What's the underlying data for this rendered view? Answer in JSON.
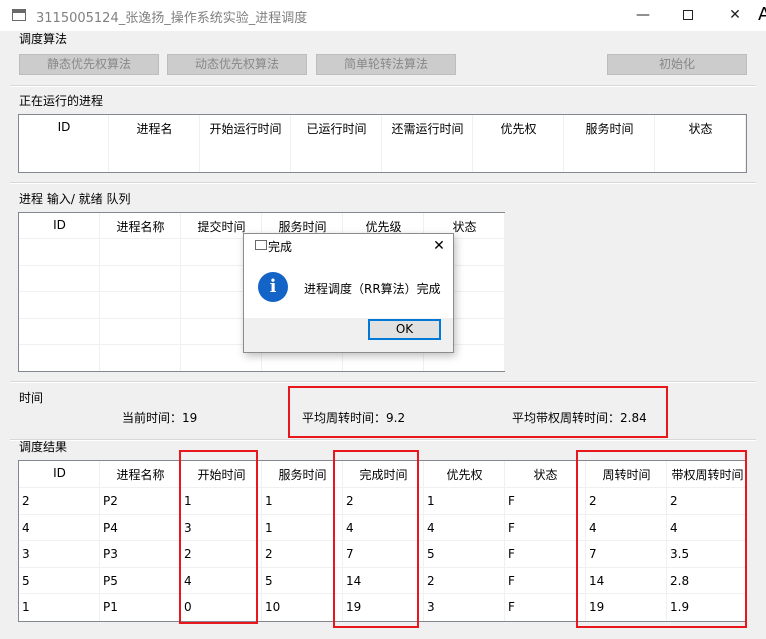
{
  "window": {
    "title": "3115005124_张逸扬_操作系统实验_进程调度",
    "min_glyph": "—",
    "close_glyph": "✕",
    "edge_char": "A"
  },
  "algo": {
    "label": "调度算法",
    "static_btn": "静态优先权算法",
    "dynamic_btn": "动态优先权算法",
    "rr_btn": "简单轮转法算法",
    "init_btn": "初始化"
  },
  "running": {
    "label": "正在运行的进程",
    "headers": [
      "ID",
      "进程名",
      "开始运行时间",
      "已运行时间",
      "还需运行时间",
      "优先权",
      "服务时间",
      "状态"
    ]
  },
  "queue": {
    "label": "进程 输入/ 就绪 队列",
    "headers": [
      "ID",
      "进程名称",
      "提交时间",
      "服务时间",
      "优先级",
      "状态"
    ]
  },
  "time": {
    "label": "时间",
    "current": "当前时间：19",
    "avg_turnaround": "平均周转时间：9.2",
    "avg_weighted": "平均带权周转时间：2.84"
  },
  "results": {
    "label": "调度结果",
    "headers": [
      "ID",
      "进程名称",
      "开始时间",
      "服务时间",
      "完成时间",
      "优先权",
      "状态",
      "周转时间",
      "带权周转时间"
    ],
    "rows": [
      [
        "2",
        "P2",
        "1",
        "1",
        "2",
        "1",
        "F",
        "2",
        "2"
      ],
      [
        "4",
        "P4",
        "3",
        "1",
        "4",
        "4",
        "F",
        "4",
        "4"
      ],
      [
        "3",
        "P3",
        "2",
        "2",
        "7",
        "5",
        "F",
        "7",
        "3.5"
      ],
      [
        "5",
        "P5",
        "4",
        "5",
        "14",
        "2",
        "F",
        "14",
        "2.8"
      ],
      [
        "1",
        "P1",
        "0",
        "10",
        "19",
        "3",
        "F",
        "19",
        "1.9"
      ]
    ]
  },
  "dialog": {
    "title": "完成",
    "info_glyph": "i",
    "close_glyph": "✕",
    "message": "进程调度（RR算法）完成",
    "ok": "OK"
  },
  "accent": {
    "highlight": "#e8161d",
    "dialog_focus": "#0078d7",
    "info": "#1464c8"
  }
}
